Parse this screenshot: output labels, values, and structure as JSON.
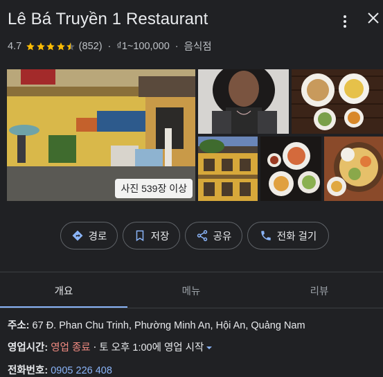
{
  "header": {
    "title": "Lê Bá Truyền 1 Restaurant",
    "more_icon": "more-vert-icon",
    "close_icon": "close-icon"
  },
  "meta": {
    "rating": "4.7",
    "stars_filled": 4.5,
    "review_count": "(852)",
    "price": "₫1~100,000",
    "separator": "·",
    "category": "음식점"
  },
  "photos": {
    "count_label": "사진 539장 이상"
  },
  "actions": [
    {
      "label": "경로",
      "icon": "directions-icon"
    },
    {
      "label": "저장",
      "icon": "bookmark-icon"
    },
    {
      "label": "공유",
      "icon": "share-icon"
    },
    {
      "label": "전화 걸기",
      "icon": "phone-icon"
    }
  ],
  "tabs": [
    {
      "label": "개요",
      "active": true
    },
    {
      "label": "메뉴",
      "active": false
    },
    {
      "label": "리뷰",
      "active": false
    }
  ],
  "details": {
    "address_label": "주소:",
    "address_value": "67 Đ. Phan Chu Trinh, Phường Minh An, Hội An, Quảng Nam",
    "hours_label": "영업시간:",
    "hours_status": "영업 종료",
    "hours_sep": "⋅",
    "hours_next": "토 오후 1:00에 영업 시작",
    "phone_label": "전화번호:",
    "phone_value": "0905 226 408"
  },
  "colors": {
    "background": "#202124",
    "star": "#fbbc04",
    "link": "#8ab4f8",
    "closed": "#f28b82"
  }
}
